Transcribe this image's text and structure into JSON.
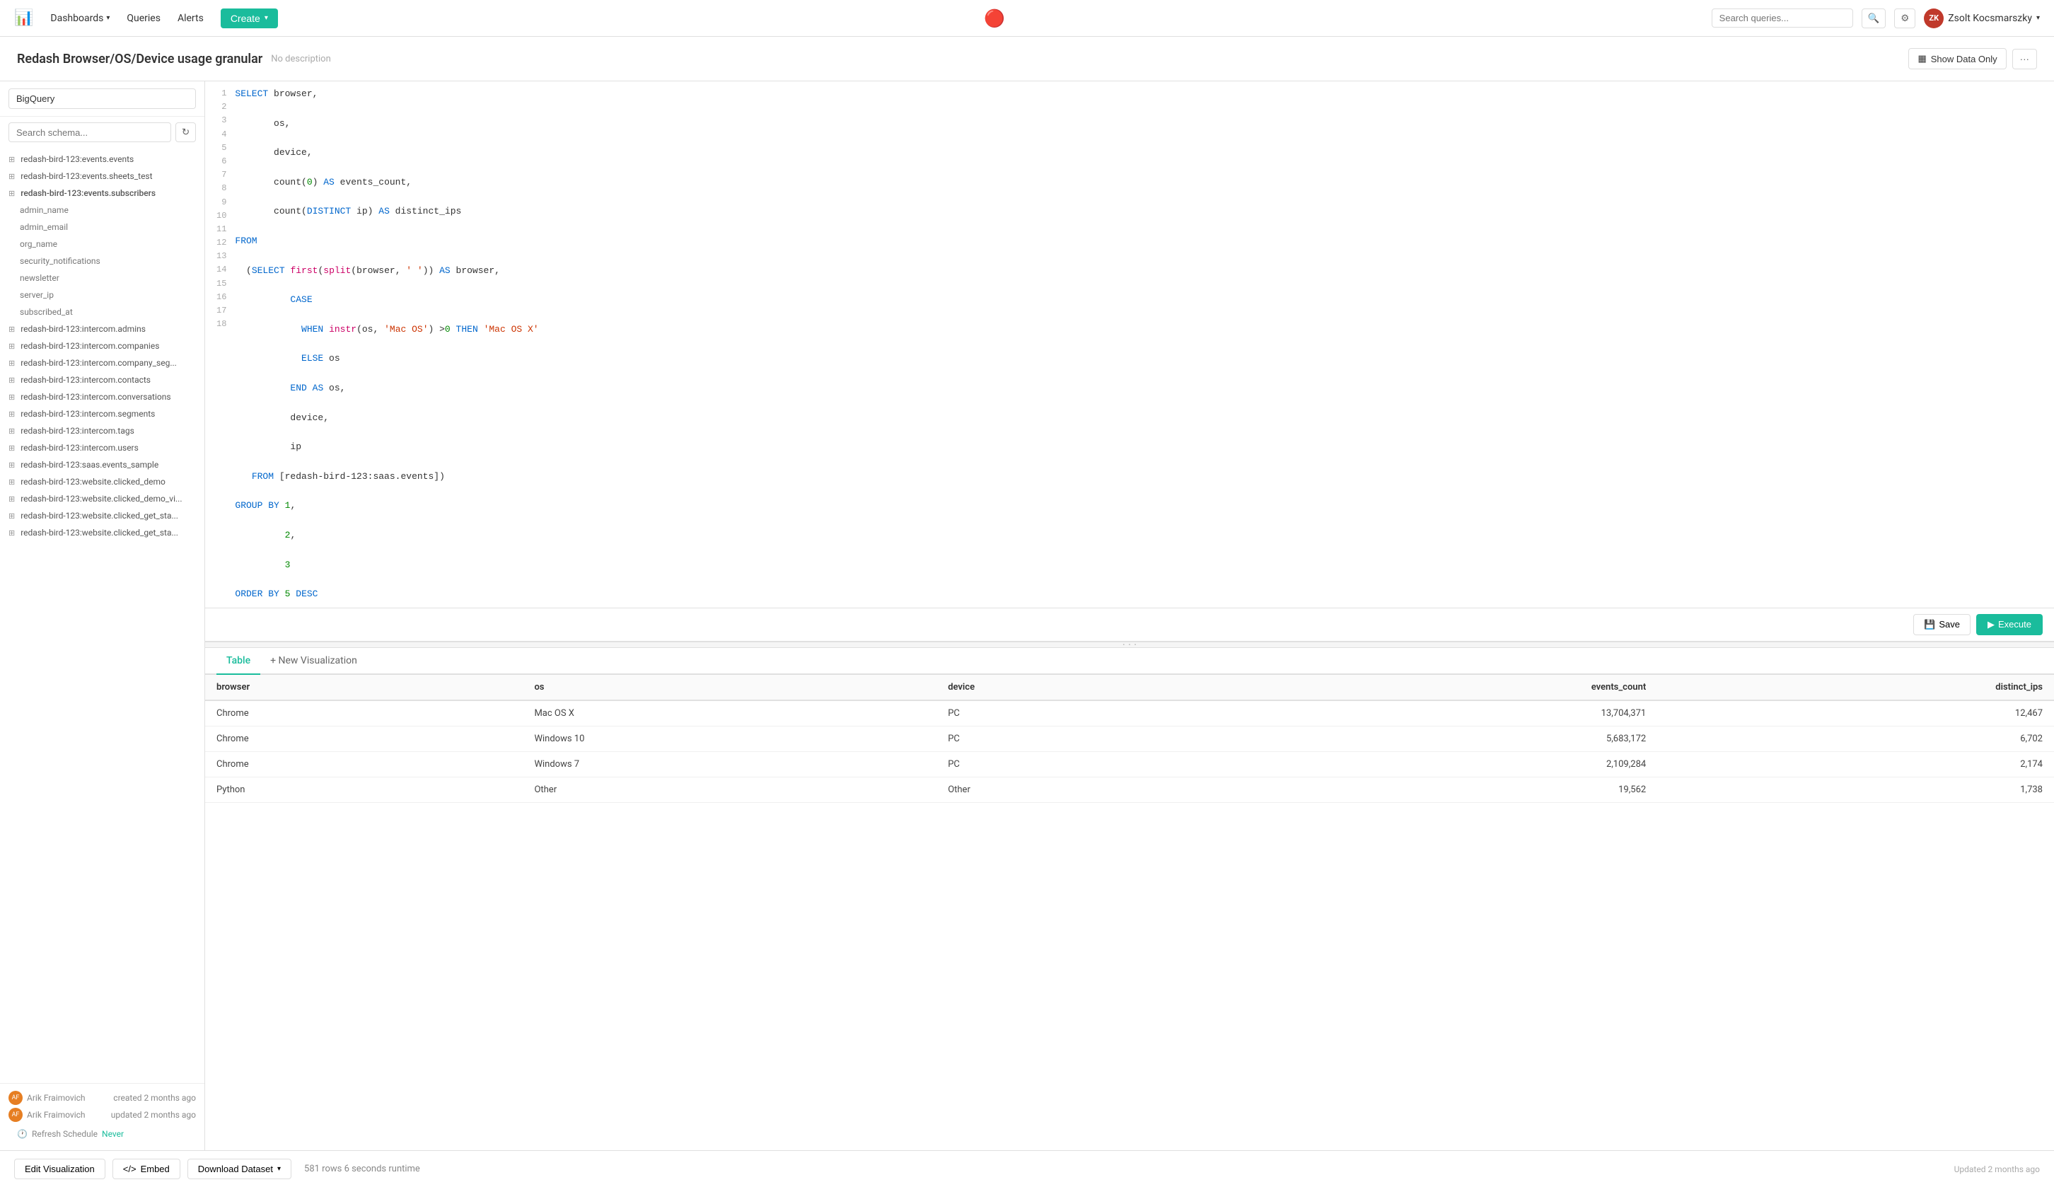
{
  "nav": {
    "dashboards_label": "Dashboards",
    "queries_label": "Queries",
    "alerts_label": "Alerts",
    "create_label": "Create",
    "search_placeholder": "Search queries...",
    "user_name": "Zsolt Kocsmarszky",
    "user_initials": "ZK"
  },
  "page": {
    "title": "Redash Browser/OS/Device usage granular",
    "description": "No description",
    "show_data_only": "Show Data Only",
    "more_label": "···"
  },
  "sidebar": {
    "datasource": "BigQuery",
    "schema_search_placeholder": "Search schema...",
    "items": [
      {
        "name": "redash-bird-123:events.events",
        "type": "table"
      },
      {
        "name": "redash-bird-123:events.sheets_test",
        "type": "table"
      },
      {
        "name": "redash-bird-123:events.subscribers",
        "type": "table-expanded"
      },
      {
        "name": "admin_name",
        "type": "child"
      },
      {
        "name": "admin_email",
        "type": "child"
      },
      {
        "name": "org_name",
        "type": "child"
      },
      {
        "name": "security_notifications",
        "type": "child"
      },
      {
        "name": "newsletter",
        "type": "child"
      },
      {
        "name": "server_ip",
        "type": "child"
      },
      {
        "name": "subscribed_at",
        "type": "child"
      },
      {
        "name": "redash-bird-123:intercom.admins",
        "type": "table"
      },
      {
        "name": "redash-bird-123:intercom.companies",
        "type": "table"
      },
      {
        "name": "redash-bird-123:intercom.company_seg...",
        "type": "table"
      },
      {
        "name": "redash-bird-123:intercom.contacts",
        "type": "table"
      },
      {
        "name": "redash-bird-123:intercom.conversations",
        "type": "table"
      },
      {
        "name": "redash-bird-123:intercom.segments",
        "type": "table"
      },
      {
        "name": "redash-bird-123:intercom.tags",
        "type": "table"
      },
      {
        "name": "redash-bird-123:intercom.users",
        "type": "table"
      },
      {
        "name": "redash-bird-123:saas.events_sample",
        "type": "table"
      },
      {
        "name": "redash-bird-123:website.clicked_demo",
        "type": "table"
      },
      {
        "name": "redash-bird-123:website.clicked_demo_vi...",
        "type": "table"
      },
      {
        "name": "redash-bird-123:website.clicked_get_sta...",
        "type": "table"
      },
      {
        "name": "redash-bird-123:website.clicked_get_sta...",
        "type": "table"
      }
    ],
    "created_by": "Arik Fraimovich",
    "created_at": "created 2 months ago",
    "updated_by": "Arik Fraimovich",
    "updated_at": "updated 2 months ago",
    "refresh_label": "Refresh Schedule",
    "never_label": "Never"
  },
  "editor": {
    "lines": [
      {
        "num": 1,
        "code": "SELECT browser,"
      },
      {
        "num": 2,
        "code": "       os,"
      },
      {
        "num": 3,
        "code": "       device,"
      },
      {
        "num": 4,
        "code": "       count(0) AS events_count,"
      },
      {
        "num": 5,
        "code": "       count(DISTINCT ip) AS distinct_ips"
      },
      {
        "num": 6,
        "code": "FROM"
      },
      {
        "num": 7,
        "code": "  (SELECT first(split(browser, ' ')) AS browser,"
      },
      {
        "num": 8,
        "code": "          CASE"
      },
      {
        "num": 9,
        "code": "            WHEN instr(os, 'Mac OS') >0 THEN 'Mac OS X'"
      },
      {
        "num": 10,
        "code": "            ELSE os"
      },
      {
        "num": 11,
        "code": "          END AS os,"
      },
      {
        "num": 12,
        "code": "          device,"
      },
      {
        "num": 13,
        "code": "          ip"
      },
      {
        "num": 14,
        "code": "   FROM [redash-bird-123:saas.events])"
      },
      {
        "num": 15,
        "code": "GROUP BY 1,"
      },
      {
        "num": 16,
        "code": "         2,"
      },
      {
        "num": 17,
        "code": "         3"
      },
      {
        "num": 18,
        "code": "ORDER BY 5 DESC"
      }
    ],
    "save_label": "Save",
    "execute_label": "Execute"
  },
  "results": {
    "tabs": [
      {
        "label": "Table",
        "active": true
      },
      {
        "label": "+ New Visualization",
        "active": false
      }
    ],
    "columns": [
      "browser",
      "os",
      "device",
      "events_count",
      "distinct_ips"
    ],
    "rows": [
      {
        "browser": "Chrome",
        "os": "Mac OS X",
        "device": "PC",
        "events_count": "13,704,371",
        "distinct_ips": "12,467"
      },
      {
        "browser": "Chrome",
        "os": "Windows 10",
        "device": "PC",
        "events_count": "5,683,172",
        "distinct_ips": "6,702"
      },
      {
        "browser": "Chrome",
        "os": "Windows 7",
        "device": "PC",
        "events_count": "2,109,284",
        "distinct_ips": "2,174"
      },
      {
        "browser": "Python",
        "os": "Other",
        "device": "Other",
        "events_count": "19,562",
        "distinct_ips": "1,738"
      }
    ]
  },
  "bottom_bar": {
    "edit_viz_label": "Edit Visualization",
    "embed_label": "Embed",
    "download_label": "Download Dataset",
    "stats": "581 rows  6 seconds runtime",
    "updated_label": "Updated 2 months ago"
  }
}
